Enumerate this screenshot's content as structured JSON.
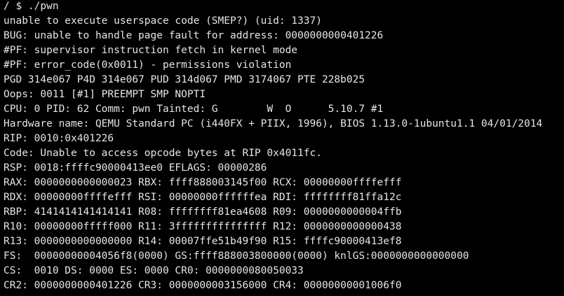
{
  "terminal": {
    "lines": [
      "/ $ ./pwn",
      "unable to execute userspace code (SMEP?) (uid: 1337)",
      "BUG: unable to handle page fault for address: 0000000000401226",
      "#PF: supervisor instruction fetch in kernel mode",
      "#PF: error_code(0x0011) - permissions violation",
      "PGD 314e067 P4D 314e067 PUD 314d067 PMD 3174067 PTE 228b025",
      "Oops: 0011 [#1] PREEMPT SMP NOPTI",
      "CPU: 0 PID: 62 Comm: pwn Tainted: G        W  O      5.10.7 #1",
      "Hardware name: QEMU Standard PC (i440FX + PIIX, 1996), BIOS 1.13.0-1ubuntu1.1 04/01/2014",
      "RIP: 0010:0x401226",
      "Code: Unable to access opcode bytes at RIP 0x4011fc.",
      "RSP: 0018:ffffc90000413ee0 EFLAGS: 00000286",
      "RAX: 0000000000000023 RBX: ffff888003145f00 RCX: 00000000ffffefff",
      "RDX: 00000000ffffefff RSI: 00000000ffffffea RDI: ffffffff81ffa12c",
      "RBP: 4141414141414141 R08: ffffffff81ea4608 R09: 0000000000004ffb",
      "R10: 00000000fffff000 R11: 3fffffffffffffff R12: 0000000000000438",
      "R13: 0000000000000000 R14: 00007ffe51b49f90 R15: ffffc90000413ef8",
      "FS:  00000000004056f8(0000) GS:ffff888003800000(0000) knlGS:0000000000000000",
      "CS:  0010 DS: 0000 ES: 0000 CR0: 0000000080050033",
      "CR2: 0000000000401226 CR3: 0000000003156000 CR4: 00000000001006f0"
    ]
  }
}
